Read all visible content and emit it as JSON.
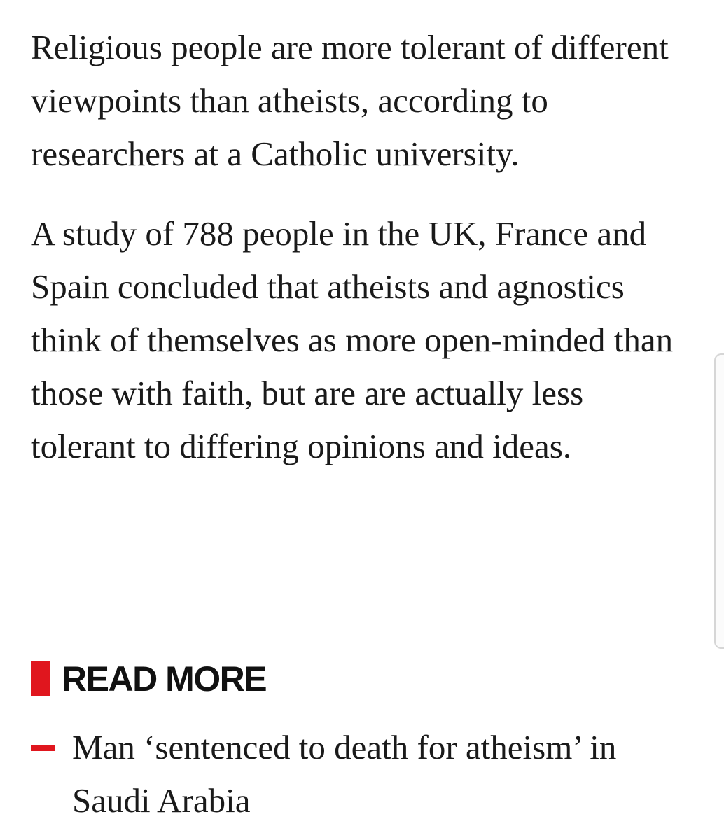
{
  "article": {
    "paragraphs": [
      "Religious people are more tolerant of different viewpoints than atheists, according to researchers at a Catholic university.",
      "A study of 788 people in the UK, France and Spain concluded that atheists and agnostics think of themselves as more open-minded than those with faith, but are are actually less tolerant to differing opinions and ideas."
    ]
  },
  "read_more": {
    "label": "READ MORE",
    "items": [
      {
        "title": "Man ‘sentenced to death for atheism’ in Saudi Arabia"
      }
    ]
  },
  "colors": {
    "accent": "#e0161e",
    "text": "#1a1a1a",
    "background": "#ffffff"
  }
}
